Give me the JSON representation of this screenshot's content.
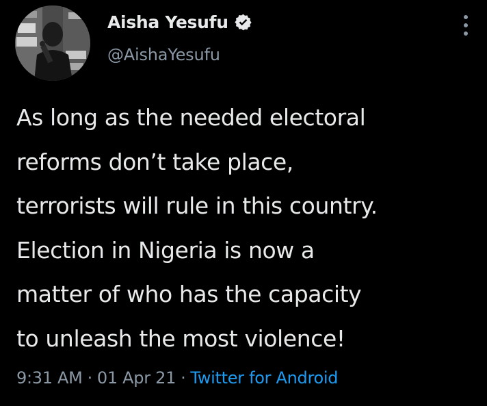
{
  "author": {
    "display_name": "Aisha Yesufu",
    "handle": "@AishaYesufu",
    "verified": true,
    "avatar_icon": "profile-photo"
  },
  "tweet": {
    "lines": [
      "As long as the needed electoral",
      "reforms don’t take place,",
      "terrorists will rule in this country.",
      "Election in Nigeria is now a",
      "matter of who has the capacity",
      "to unleash the most violence!"
    ]
  },
  "meta": {
    "time": "9:31 AM",
    "separator": "·",
    "date": "01 Apr 21",
    "source": "Twitter for Android"
  },
  "colors": {
    "background": "#000000",
    "text": "#e7e9ea",
    "muted": "#8b98a5",
    "link": "#1d9bf0"
  },
  "icons": {
    "verified": "verified-badge-icon",
    "more": "more-options-icon"
  }
}
